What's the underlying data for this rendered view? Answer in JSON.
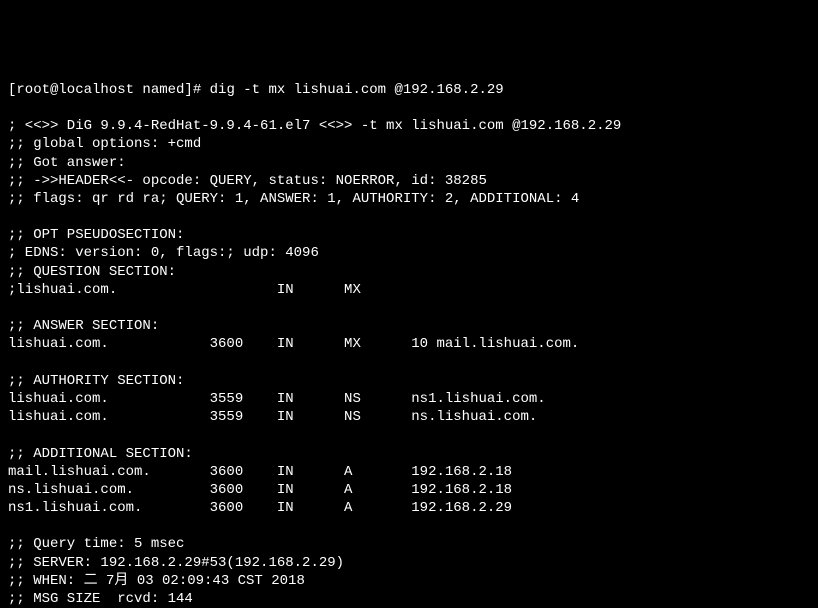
{
  "prompt": "[root@localhost named]# ",
  "command": "dig -t mx lishuai.com @192.168.2.29",
  "header_line": "; <<>> DiG 9.9.4-RedHat-9.9.4-61.el7 <<>> -t mx lishuai.com @192.168.2.29",
  "global_options": ";; global options: +cmd",
  "got_answer": ";; Got answer:",
  "header_info": ";; ->>HEADER<<- opcode: QUERY, status: NOERROR, id: 38285",
  "flags": ";; flags: qr rd ra; QUERY: 1, ANSWER: 1, AUTHORITY: 2, ADDITIONAL: 4",
  "opt_header": ";; OPT PSEUDOSECTION:",
  "edns": "; EDNS: version: 0, flags:; udp: 4096",
  "question_header": ";; QUESTION SECTION:",
  "question_line": ";lishuai.com.                   IN      MX",
  "answer_header": ";; ANSWER SECTION:",
  "answer_line": "lishuai.com.            3600    IN      MX      10 mail.lishuai.com.",
  "authority_header": ";; AUTHORITY SECTION:",
  "authority_line1": "lishuai.com.            3559    IN      NS      ns1.lishuai.com.",
  "authority_line2": "lishuai.com.            3559    IN      NS      ns.lishuai.com.",
  "additional_header": ";; ADDITIONAL SECTION:",
  "additional_line1": "mail.lishuai.com.       3600    IN      A       192.168.2.18",
  "additional_line2": "ns.lishuai.com.         3600    IN      A       192.168.2.18",
  "additional_line3": "ns1.lishuai.com.        3600    IN      A       192.168.2.29",
  "query_time": ";; Query time: 5 msec",
  "server": ";; SERVER: 192.168.2.29#53(192.168.2.29)",
  "when": ";; WHEN: 二 7月 03 02:09:43 CST 2018",
  "msg_size": ";; MSG SIZE  rcvd: 144"
}
